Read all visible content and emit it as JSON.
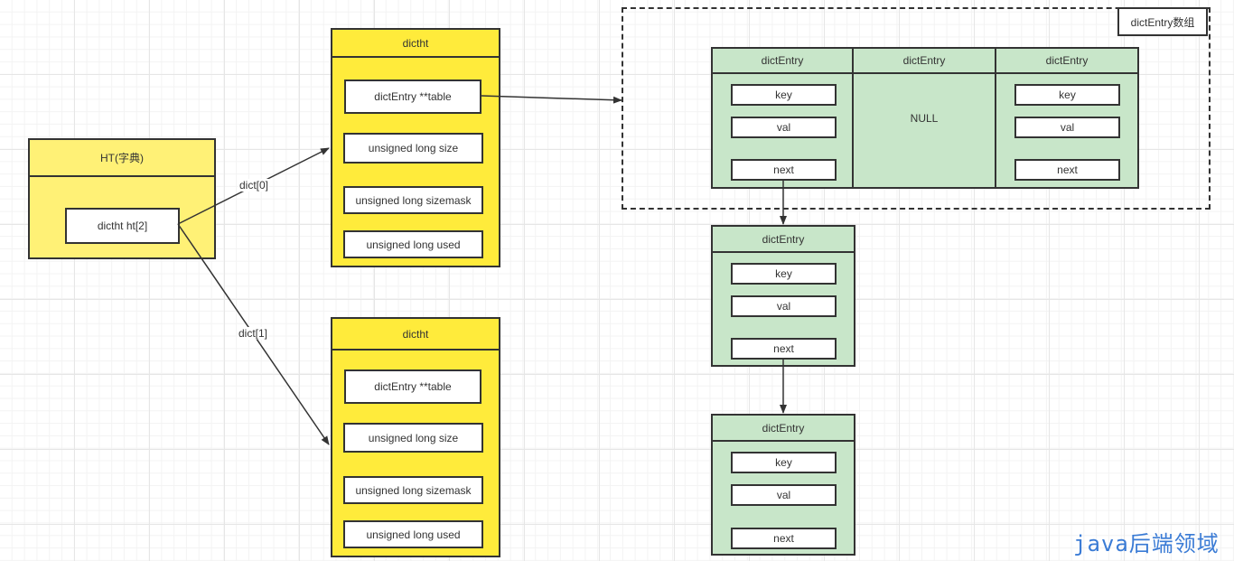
{
  "ht": {
    "title": "HT(字典)",
    "field": "dictht ht[2]"
  },
  "edges": {
    "dict0": "dict[0]",
    "dict1": "dict[1]"
  },
  "dictht": [
    {
      "title": "dictht",
      "fields": [
        "dictEntry **table",
        "unsigned long size",
        "unsigned long sizemask",
        "unsigned long used"
      ]
    },
    {
      "title": "dictht",
      "fields": [
        "dictEntry **table",
        "unsigned long size",
        "unsigned long sizemask",
        "unsigned long used"
      ]
    }
  ],
  "array": {
    "label": "dictEntry数组",
    "entries": [
      {
        "title": "dictEntry",
        "fields": [
          "key",
          "val",
          "next"
        ]
      },
      {
        "title": "dictEntry",
        "null_text": "NULL"
      },
      {
        "title": "dictEntry",
        "fields": [
          "key",
          "val",
          "next"
        ]
      }
    ]
  },
  "chain": [
    {
      "title": "dictEntry",
      "fields": [
        "key",
        "val",
        "next"
      ]
    },
    {
      "title": "dictEntry",
      "fields": [
        "key",
        "val",
        "next"
      ]
    }
  ],
  "watermark": "java后端领域",
  "colors": {
    "ht": "#fff176",
    "dictht": "#ffeb3b",
    "entry": "#c8e6c9",
    "watermark": "#3a7bd5"
  }
}
